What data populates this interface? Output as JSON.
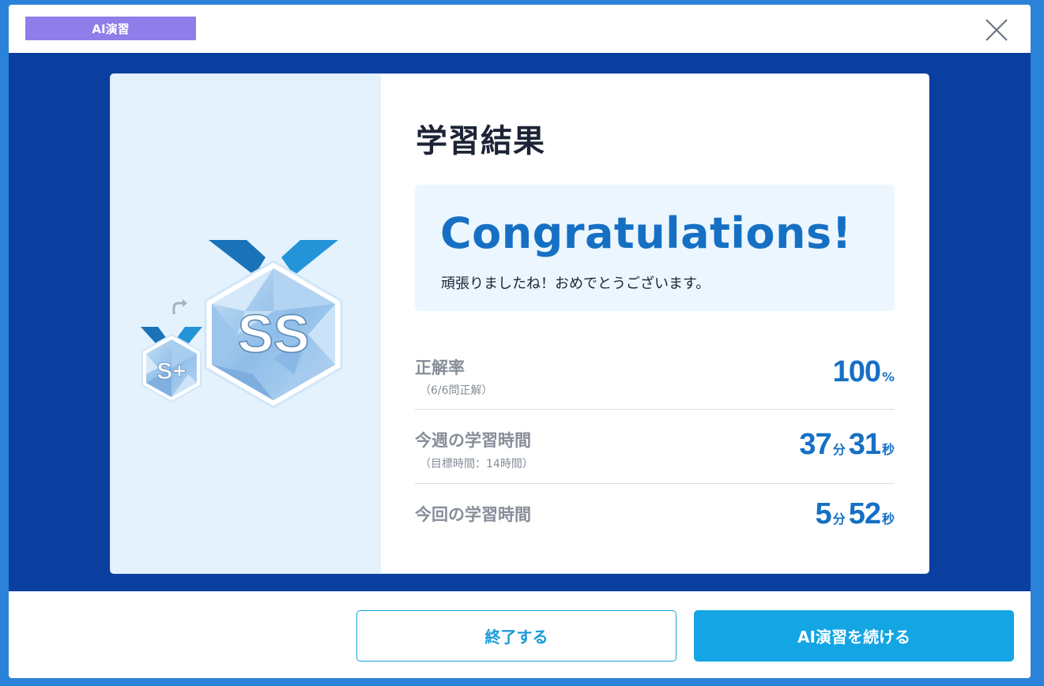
{
  "header": {
    "mode_badge": "AI演習",
    "close_icon": "close-icon"
  },
  "badges": {
    "previous_rank": "S+",
    "current_rank": "SS",
    "arrow_icon": "arrow-right-up-icon"
  },
  "result": {
    "title": "学習結果",
    "congrats_heading": "Congratulations!",
    "congrats_message": "頑張りましたね！おめでとうございます。"
  },
  "stats": {
    "accuracy": {
      "label": "正解率",
      "sub": "（6/6問正解）",
      "value": "100",
      "unit": "%"
    },
    "weekly_time": {
      "label": "今週の学習時間",
      "sub": "（目標時間：14時間）",
      "minutes": "37",
      "minutes_unit": "分",
      "seconds": "31",
      "seconds_unit": "秒"
    },
    "session_time": {
      "label": "今回の学習時間",
      "minutes": "5",
      "minutes_unit": "分",
      "seconds": "52",
      "seconds_unit": "秒"
    }
  },
  "footer": {
    "end_label": "終了する",
    "continue_label": "AI演習を続ける"
  },
  "colors": {
    "accent_blue": "#1570c4",
    "button_blue": "#13a5e4",
    "badge_purple": "#8f7de9",
    "backdrop_navy": "#0b3f9f"
  }
}
